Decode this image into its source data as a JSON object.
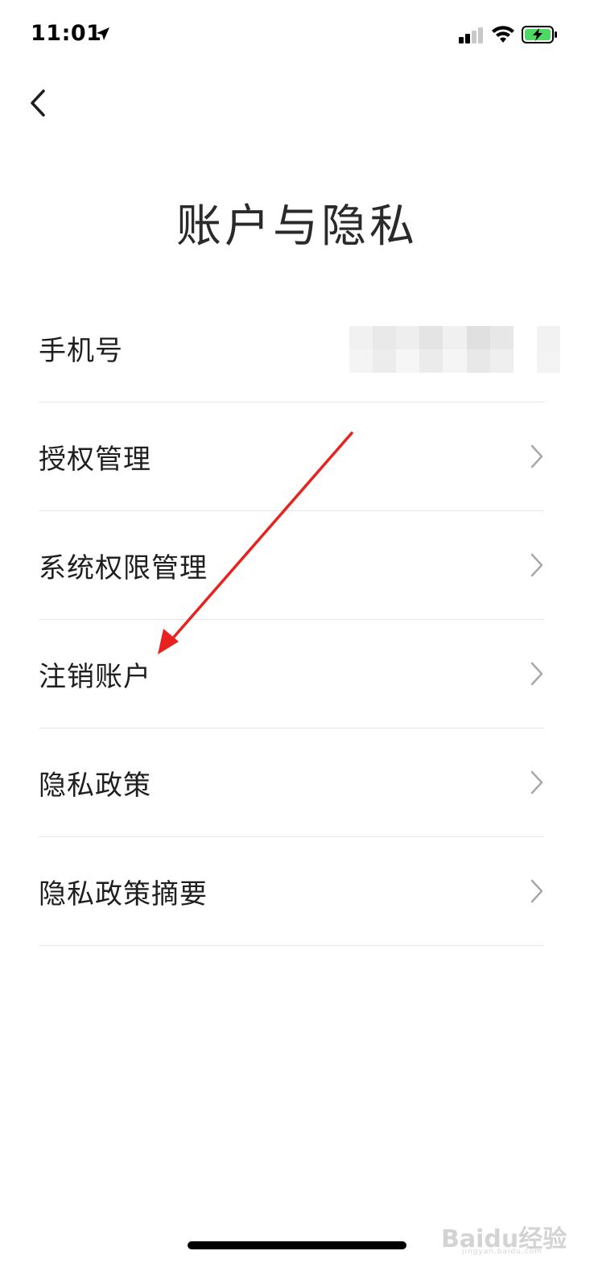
{
  "status_bar": {
    "time": "11:01",
    "icons": [
      "location-arrow-icon",
      "cellular-signal-icon",
      "wifi-icon",
      "battery-charging-icon"
    ],
    "battery_color": "#4cd964"
  },
  "nav": {
    "back_icon": "chevron-left-icon"
  },
  "page": {
    "title": "账户与隐私"
  },
  "settings": [
    {
      "label": "手机号",
      "value_blurred": true
    },
    {
      "label": "授权管理",
      "chevron": true
    },
    {
      "label": "系统权限管理",
      "chevron": true
    },
    {
      "label": "注销账户",
      "chevron": true
    },
    {
      "label": "隐私政策",
      "chevron": true
    },
    {
      "label": "隐私政策摘要",
      "chevron": true
    }
  ],
  "annotation": {
    "type": "arrow",
    "color": "#e8231f",
    "target": "注销账户"
  },
  "watermark": {
    "text": "Baidu经验",
    "subtext": "jingyan.baidu.com"
  }
}
